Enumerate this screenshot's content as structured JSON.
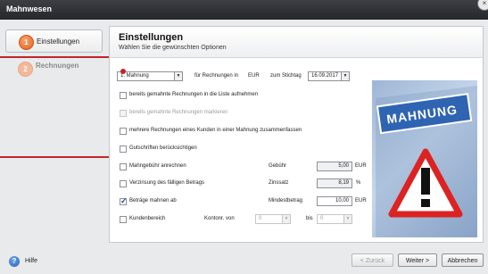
{
  "window": {
    "title": "Mahnwesen"
  },
  "steps": [
    {
      "number": "1",
      "label": "Einstellungen"
    },
    {
      "number": "2",
      "label": "Rechnungen"
    }
  ],
  "header": {
    "title": "Einstellungen",
    "subtitle": "Wählen Sie die gewünschten Optionen"
  },
  "form": {
    "mahnung_select": "1. Mahnung",
    "fuer_rechnungen_in": "für Rechnungen in",
    "currency": "EUR",
    "zum_stichtag": "zum Stichtag",
    "stichtag_value": "16.09.2017",
    "cb_gemahnt_aufnehmen": "bereits gemahnte Rechnungen in die Liste aufnehmen",
    "cb_gemahnt_markieren": "bereits gemahnte Rechnungen markieren",
    "cb_zusammenfassen": "mehrere Rechnungen eines Kunden in einer Mahnung zusammenfassen",
    "cb_gutschriften": "Gutschriften berücksichtigen",
    "cb_mahngebuehr": "Mahngebühr anrechnen",
    "gebuehr_label": "Gebühr",
    "gebuehr_value": "5,00",
    "gebuehr_unit": "EUR",
    "cb_verzinsung": "Verzinsung des fälligen Betrags",
    "zinssatz_label": "Zinssatz",
    "zinssatz_value": "8,19",
    "zinssatz_unit": "%",
    "cb_betraege": "Beträge mahnen ab",
    "mindest_label": "Mindestbetrag",
    "mindest_value": "10,00",
    "mindest_unit": "EUR",
    "cb_kundenbereich": "Kundenbereich",
    "kontonr_von_label": "Kontonr. von",
    "von_value": "0",
    "bis_label": "bis",
    "bis_value": "0"
  },
  "illustration": {
    "sign_text": "MAHNUNG"
  },
  "footer": {
    "help": "Hilfe",
    "back": "< Zurück",
    "next": "Weiter >",
    "cancel": "Abbrechen"
  },
  "colors": {
    "accent": "#e2621f",
    "annotation": "#c0262a",
    "titlebar": "#2f3136"
  }
}
